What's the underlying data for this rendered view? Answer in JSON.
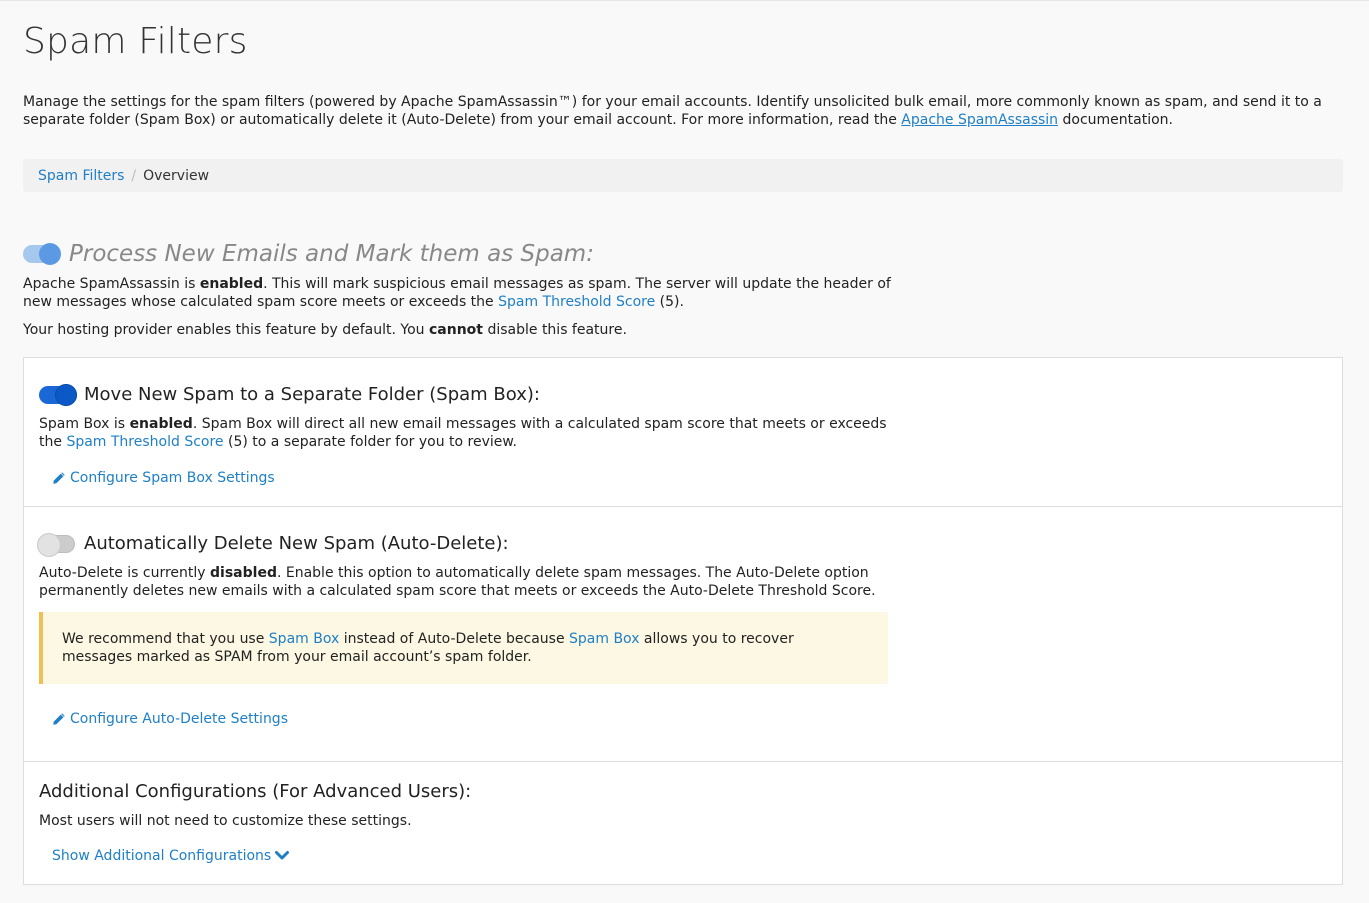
{
  "page": {
    "title": "Spam Filters",
    "intro_part1": "Manage the settings for the spam filters (powered by Apache SpamAssassin™) for your email accounts. Identify unsolicited bulk email, more commonly known as spam, and send it to a separate folder (Spam Box) or automatically delete it (Auto-Delete) from your email account. For more information, read the ",
    "intro_link": "Apache SpamAssassin",
    "intro_part2": " documentation."
  },
  "breadcrumb": {
    "root": "Spam Filters",
    "separator": "/",
    "current": "Overview"
  },
  "process": {
    "heading": "Process New Emails and Mark them as Spam:",
    "toggle_state": "on",
    "text_a": "Apache SpamAssassin is ",
    "text_bold": "enabled",
    "text_b": ". This will mark suspicious email messages as spam. The server will update the header of new messages whose calculated spam score meets or exceeds the ",
    "threshold_link": "Spam Threshold Score",
    "text_c": " (5).",
    "note_a": "Your hosting provider enables this feature by default. You ",
    "note_bold": "cannot",
    "note_b": " disable this feature."
  },
  "spambox": {
    "heading": "Move New Spam to a Separate Folder (Spam Box):",
    "toggle_state": "on",
    "text_a": "Spam Box is ",
    "text_bold": "enabled",
    "text_b": ". Spam Box will direct all new email messages with a calculated spam score that meets or exceeds the ",
    "threshold_link": "Spam Threshold Score",
    "text_c": " (5) to a separate folder for you to review.",
    "configure_label": "Configure Spam Box Settings"
  },
  "autodelete": {
    "heading": "Automatically Delete New Spam (Auto-Delete):",
    "toggle_state": "off",
    "text_a": "Auto-Delete is currently ",
    "text_bold": "disabled",
    "text_b": ". Enable this option to automatically delete spam messages. The Auto-Delete option permanently deletes new emails with a calculated spam score that meets or exceeds the Auto-Delete Threshold Score.",
    "alert_a": "We recommend that you use ",
    "alert_link1": "Spam Box",
    "alert_b": " instead of Auto-Delete because ",
    "alert_link2": "Spam Box",
    "alert_c": " allows you to recover messages marked as SPAM from your email account’s spam folder.",
    "configure_label": "Configure Auto-Delete Settings"
  },
  "advanced": {
    "heading": "Additional Configurations (For Advanced Users):",
    "text": "Most users will not need to customize these settings.",
    "show_label": "Show Additional Configurations"
  },
  "colors": {
    "link": "#1f7fc6",
    "toggle_on": "#0b59c6",
    "alert_bg": "#fcf8e3",
    "alert_border": "#f0c054"
  },
  "icons": {
    "configure": "pencil-icon",
    "expand": "chevron-down-icon"
  }
}
